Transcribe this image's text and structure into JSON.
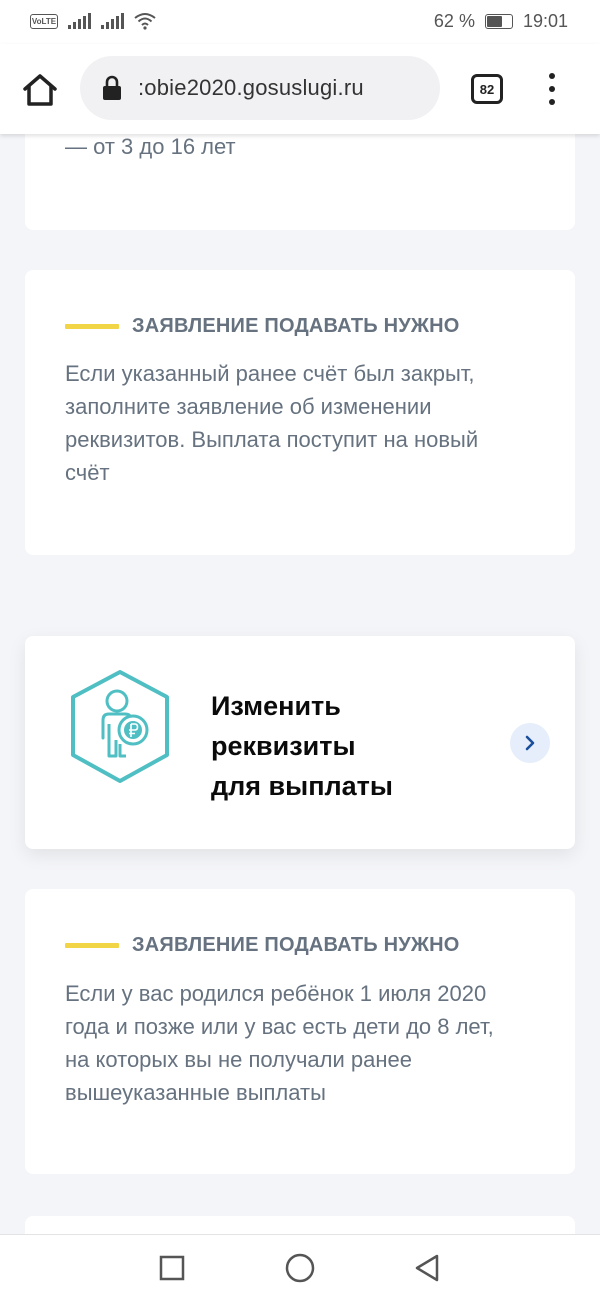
{
  "status_bar": {
    "volte": "VoLTE",
    "battery_percent": "62 %",
    "battery_level": 0.62,
    "time": "19:01"
  },
  "browser": {
    "url": ":obie2020.gosuslugi.ru",
    "tab_count": "82"
  },
  "cards": {
    "top_fragment": "— от 3 до 16 лет",
    "info1": {
      "heading": "ЗАЯВЛЕНИЕ ПОДАВАТЬ НУЖНО",
      "lines": [
        "Если указанный ранее счёт был закрыт,",
        "заполните заявление об изменении",
        "реквизитов. Выплата поступит на новый",
        "счёт"
      ]
    },
    "action": {
      "title_lines": [
        "Изменить",
        "реквизиты",
        "для выплаты"
      ],
      "icon": "person-ruble-hexagon-icon",
      "accent": "#4fbfc3"
    },
    "info2": {
      "heading": "ЗАЯВЛЕНИЕ ПОДАВАТЬ НУЖНО",
      "lines": [
        "Если у вас родился ребёнок 1 июля 2020",
        "года и позже или у вас есть дети до 8 лет,",
        "на которых вы не получали ранее",
        "вышеуказанные выплаты"
      ]
    }
  },
  "colors": {
    "heading_accent": "#f2d547",
    "text_muted": "#66727f",
    "chevron": "#1b4f9c"
  }
}
